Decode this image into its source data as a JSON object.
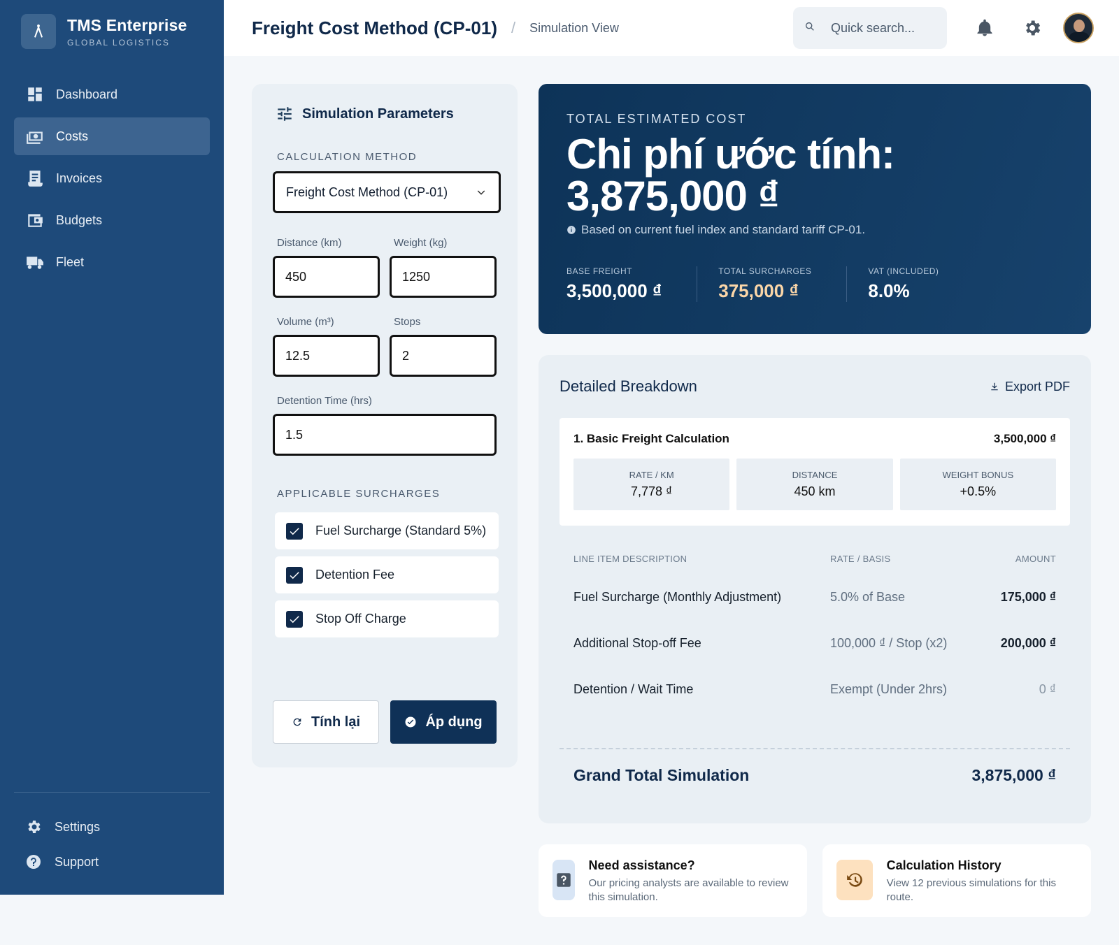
{
  "brand": {
    "title": "TMS Enterprise",
    "subtitle": "GLOBAL LOGISTICS"
  },
  "nav": {
    "items": [
      {
        "label": "Dashboard",
        "icon": "dashboard-icon",
        "active": false
      },
      {
        "label": "Costs",
        "icon": "payments-icon",
        "active": true
      },
      {
        "label": "Invoices",
        "icon": "receipt-icon",
        "active": false
      },
      {
        "label": "Budgets",
        "icon": "wallet-icon",
        "active": false
      },
      {
        "label": "Fleet",
        "icon": "truck-icon",
        "active": false
      }
    ],
    "bottom": [
      {
        "label": "Settings",
        "icon": "gear-icon"
      },
      {
        "label": "Support",
        "icon": "help-icon"
      }
    ]
  },
  "header": {
    "title": "Freight Cost Method (CP-01)",
    "separator": "/",
    "crumb": "Simulation View",
    "search_placeholder": "Quick search..."
  },
  "params": {
    "title": "Simulation Parameters",
    "method_label": "CALCULATION METHOD",
    "method_value": "Freight Cost Method (CP-01)",
    "distance_label": "Distance (km)",
    "distance_value": "450",
    "weight_label": "Weight (kg)",
    "weight_value": "1250",
    "volume_label": "Volume (m³)",
    "volume_value": "12.5",
    "stops_label": "Stops",
    "stops_value": "2",
    "detention_label": "Detention Time (hrs)",
    "detention_value": "1.5",
    "surcharges_label": "APPLICABLE SURCHARGES",
    "surcharges": [
      {
        "label": "Fuel Surcharge (Standard 5%)",
        "checked": true
      },
      {
        "label": "Detention Fee",
        "checked": true
      },
      {
        "label": "Stop Off Charge",
        "checked": true
      }
    ],
    "reset_label": "Tính lại",
    "apply_label": "Áp dụng"
  },
  "total": {
    "label": "TOTAL ESTIMATED COST",
    "line1": "Chi phí ước tính:",
    "line2": "3,875,000 ₫",
    "note": "Based on current fuel index and standard tariff CP-01.",
    "stats": [
      {
        "label": "BASE FREIGHT",
        "value": "3,500,000 ₫",
        "highlight": false
      },
      {
        "label": "TOTAL SURCHARGES",
        "value": "375,000 ₫",
        "highlight": true
      },
      {
        "label": "VAT (INCLUDED)",
        "value": "8.0%",
        "highlight": false
      }
    ]
  },
  "breakdown": {
    "title": "Detailed Breakdown",
    "export_label": "Export PDF",
    "basic_title": "1. Basic Freight Calculation",
    "basic_amount": "3,500,000 ₫",
    "basic_cells": [
      {
        "label": "RATE / KM",
        "value": "7,778 ₫"
      },
      {
        "label": "DISTANCE",
        "value": "450 km"
      },
      {
        "label": "WEIGHT BONUS",
        "value": "+0.5%"
      }
    ],
    "columns": {
      "desc": "LINE ITEM DESCRIPTION",
      "rate": "RATE / BASIS",
      "amount": "AMOUNT"
    },
    "rows": [
      {
        "desc": "Fuel Surcharge (Monthly Adjustment)",
        "rate": "5.0% of Base",
        "amount": "175,000 ₫",
        "muted": false
      },
      {
        "desc": "Additional Stop-off Fee",
        "rate": "100,000 ₫ / Stop (x2)",
        "amount": "200,000 ₫",
        "muted": false
      },
      {
        "desc": "Detention / Wait Time",
        "rate": "Exempt (Under 2hrs)",
        "amount": "0 ₫",
        "muted": true
      }
    ],
    "grand_label": "Grand Total Simulation",
    "grand_value": "3,875,000 ₫"
  },
  "help": [
    {
      "title": "Need assistance?",
      "text": "Our pricing analysts are available to review this simulation.",
      "icon": "question-icon",
      "color": "#d8e5f5"
    },
    {
      "title": "Calculation History",
      "text": "View 12 previous simulations for this route.",
      "icon": "history-icon",
      "color": "#fde1bf"
    }
  ]
}
